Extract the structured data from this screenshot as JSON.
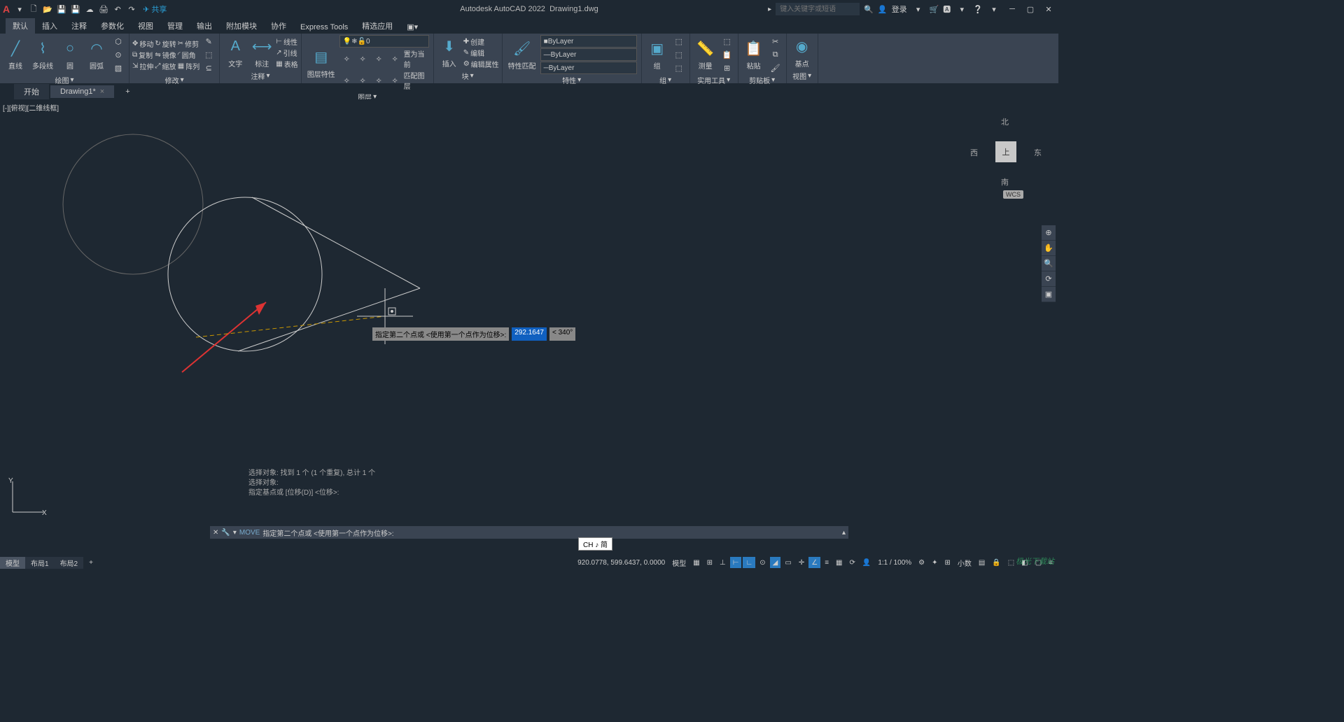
{
  "titlebar": {
    "app": "Autodesk AutoCAD 2022",
    "doc": "Drawing1.dwg",
    "search_placeholder": "键入关键字或短语",
    "login": "登录",
    "share": "共享"
  },
  "menu": {
    "tabs": [
      "默认",
      "插入",
      "注释",
      "参数化",
      "视图",
      "管理",
      "输出",
      "附加模块",
      "协作",
      "Express Tools",
      "精选应用"
    ]
  },
  "ribbon": {
    "draw": {
      "title": "绘图",
      "line": "直线",
      "pline": "多段线",
      "circle": "圆",
      "arc": "圆弧"
    },
    "modify": {
      "title": "修改",
      "move": "移动",
      "rotate": "旋转",
      "trim": "修剪",
      "copy": "复制",
      "mirror": "镜像",
      "fillet": "圆角",
      "stretch": "拉伸",
      "scale": "缩放",
      "array": "阵列"
    },
    "annotation": {
      "title": "注释",
      "text": "文字",
      "dim": "标注",
      "leader": "引线",
      "table": "表格",
      "linear": "线性"
    },
    "layer": {
      "title": "图层",
      "props": "图层特性",
      "current": "匹配图层",
      "setcurrent": "置为当前",
      "layer0": "0"
    },
    "block": {
      "title": "块",
      "insert": "插入",
      "create": "创建",
      "edit": "编辑",
      "editattr": "编辑属性"
    },
    "properties": {
      "title": "特性",
      "match": "特性匹配",
      "bylayer": "ByLayer"
    },
    "group": {
      "title": "组",
      "group": "组"
    },
    "utils": {
      "title": "实用工具",
      "measure": "测量"
    },
    "clipboard": {
      "title": "剪贴板",
      "paste": "粘贴"
    },
    "view": {
      "title": "视图",
      "base": "基点"
    }
  },
  "filetabs": {
    "start": "开始",
    "drawing": "Drawing1*"
  },
  "viewport": {
    "label": "[-][俯视][二维线框]",
    "cube": {
      "top": "上",
      "n": "北",
      "s": "南",
      "e": "东",
      "w": "西"
    },
    "wcs": "WCS"
  },
  "dyninput": {
    "prompt": "指定第二个点或 <使用第一个点作为位移>:",
    "dist": "292.1647",
    "angle": "< 340°"
  },
  "cmdhist": {
    "l1": "选择对象: 找到 1 个 (1 个重复), 总计 1 个",
    "l2": "选择对象:",
    "l3": "指定基点或 [位移(D)] <位移>:"
  },
  "cmdline": {
    "cmd": "MOVE",
    "text": "指定第二个点或 <使用第一个点作为位移>:"
  },
  "ime": "CH ♪ 简",
  "layouts": {
    "model": "模型",
    "l1": "布局1",
    "l2": "布局2"
  },
  "status": {
    "coords": "920.0778, 599.6437, 0.0000",
    "model": "模型",
    "scale": "1:1 / 100%",
    "decimal": "小数"
  },
  "watermark": "极光下载站"
}
